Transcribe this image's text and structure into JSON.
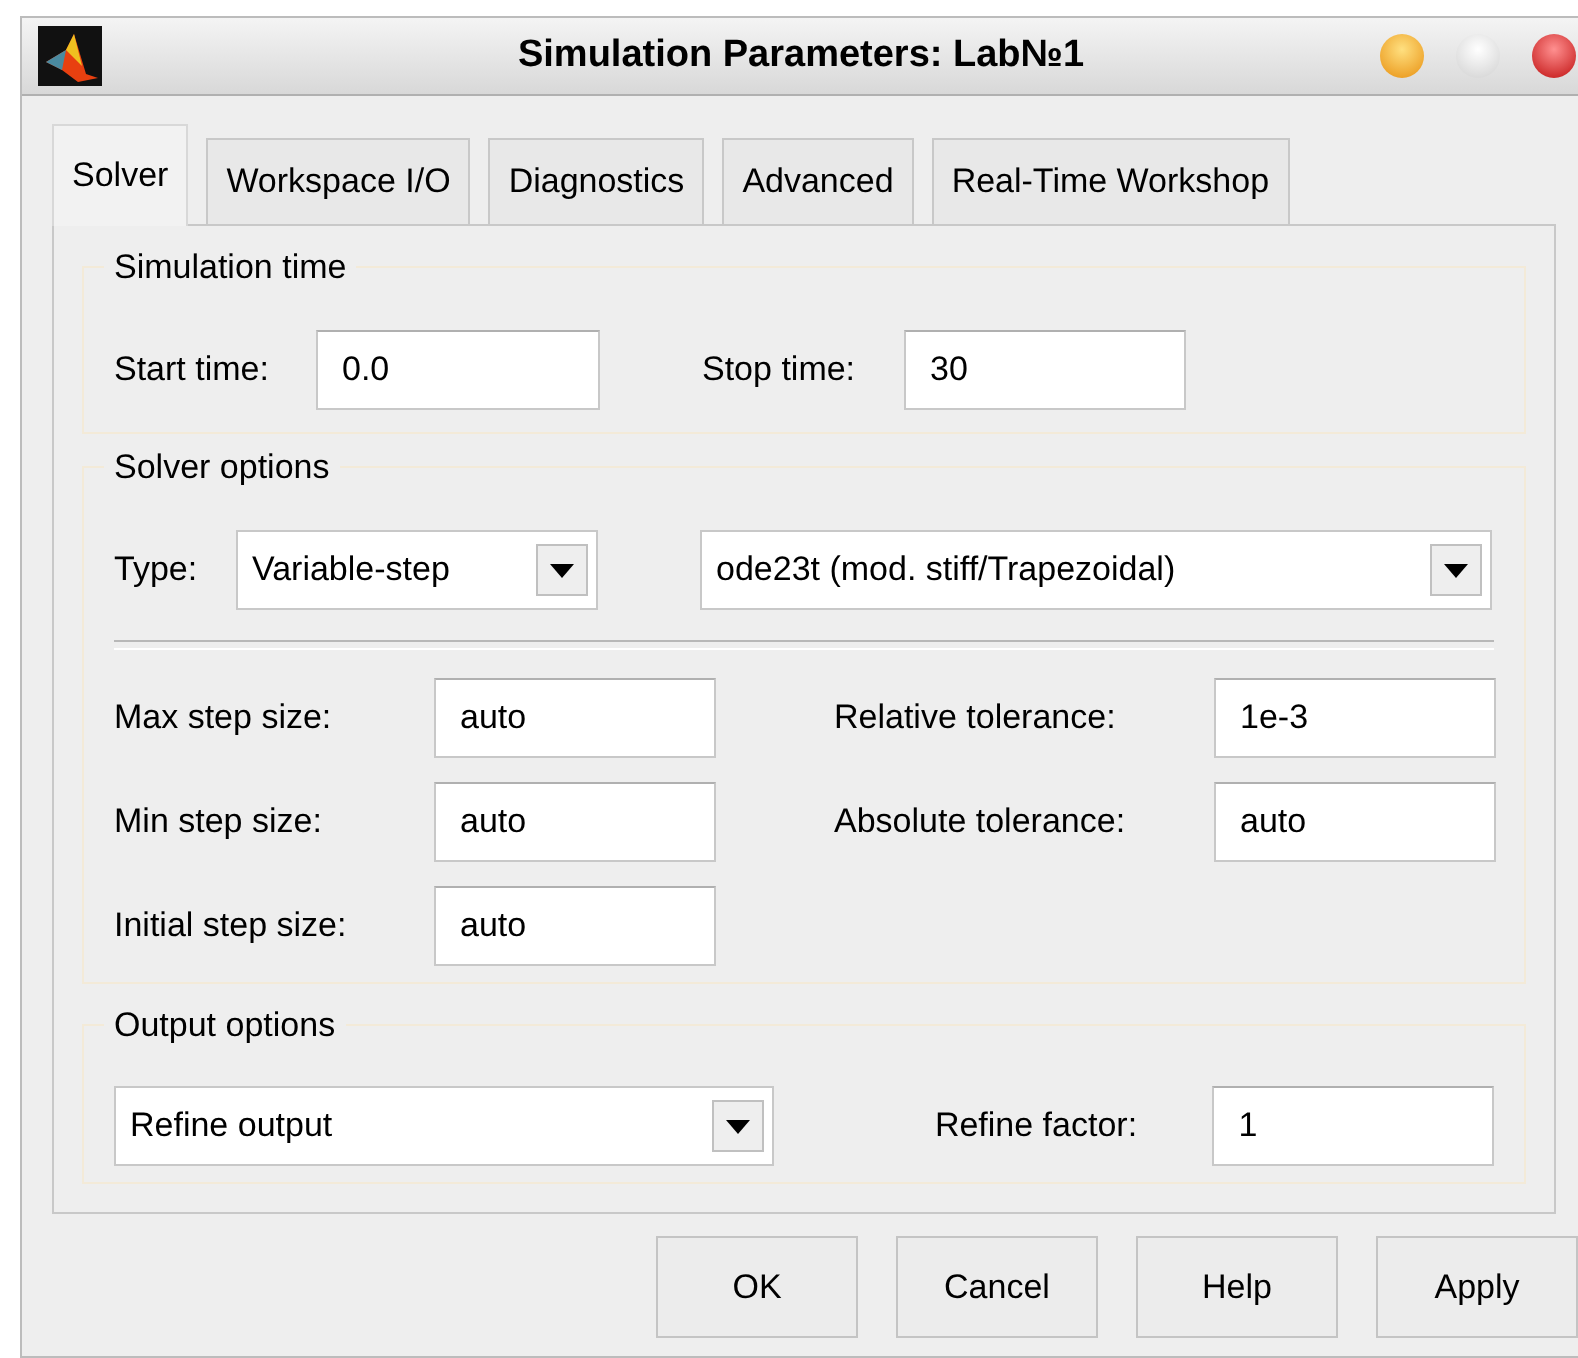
{
  "window": {
    "title": "Simulation Parameters: Lab№1"
  },
  "tabs": [
    {
      "label": "Solver",
      "selected": true
    },
    {
      "label": "Workspace I/O",
      "selected": false
    },
    {
      "label": "Diagnostics",
      "selected": false
    },
    {
      "label": "Advanced",
      "selected": false
    },
    {
      "label": "Real-Time Workshop",
      "selected": false
    }
  ],
  "simulation_time": {
    "legend": "Simulation time",
    "start_label": "Start time:",
    "start_value": "0.0",
    "stop_label": "Stop time:",
    "stop_value": "30"
  },
  "solver_options": {
    "legend": "Solver options",
    "type_label": "Type:",
    "type_value": "Variable-step",
    "solver_value": "ode23t (mod. stiff/Trapezoidal)",
    "left_fields": [
      {
        "label": "Max step size:",
        "value": "auto"
      },
      {
        "label": "Min step size:",
        "value": "auto"
      },
      {
        "label": "Initial step size:",
        "value": "auto"
      }
    ],
    "right_fields": [
      {
        "label": "Relative tolerance:",
        "value": "1e-3"
      },
      {
        "label": "Absolute tolerance:",
        "value": "auto"
      }
    ]
  },
  "output_options": {
    "legend": "Output options",
    "output_value": "Refine output",
    "factor_label": "Refine factor:",
    "factor_value": "1"
  },
  "buttons": [
    "OK",
    "Cancel",
    "Help",
    "Apply"
  ]
}
